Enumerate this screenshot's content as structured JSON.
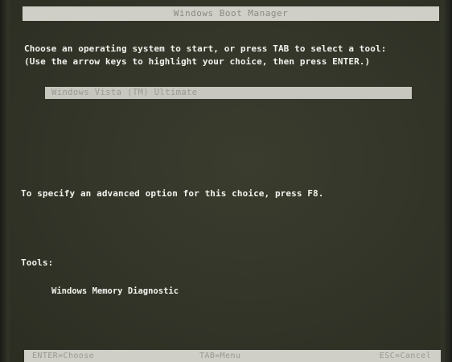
{
  "header": {
    "title": "Windows Boot Manager"
  },
  "instructions": {
    "line1": "Choose an operating system to start, or press TAB to select a tool:",
    "line2": "(Use the arrow keys to highlight your choice, then press ENTER.)"
  },
  "os_list": {
    "items": [
      {
        "label": "Windows Vista (TM) Ultimate"
      }
    ]
  },
  "advanced_hint": "To specify an advanced option for this choice, press F8.",
  "tools": {
    "heading": "Tools:",
    "items": [
      {
        "label": "Windows Memory Diagnostic"
      }
    ]
  },
  "status_bar": {
    "left": "ENTER=Choose",
    "middle": "TAB=Menu",
    "right": "ESC=Cancel"
  },
  "colors": {
    "background": "#34362a",
    "text": "#f3f3ee",
    "highlight_bar": "#c7c7c0",
    "title_bar": "#cfcfc8"
  }
}
